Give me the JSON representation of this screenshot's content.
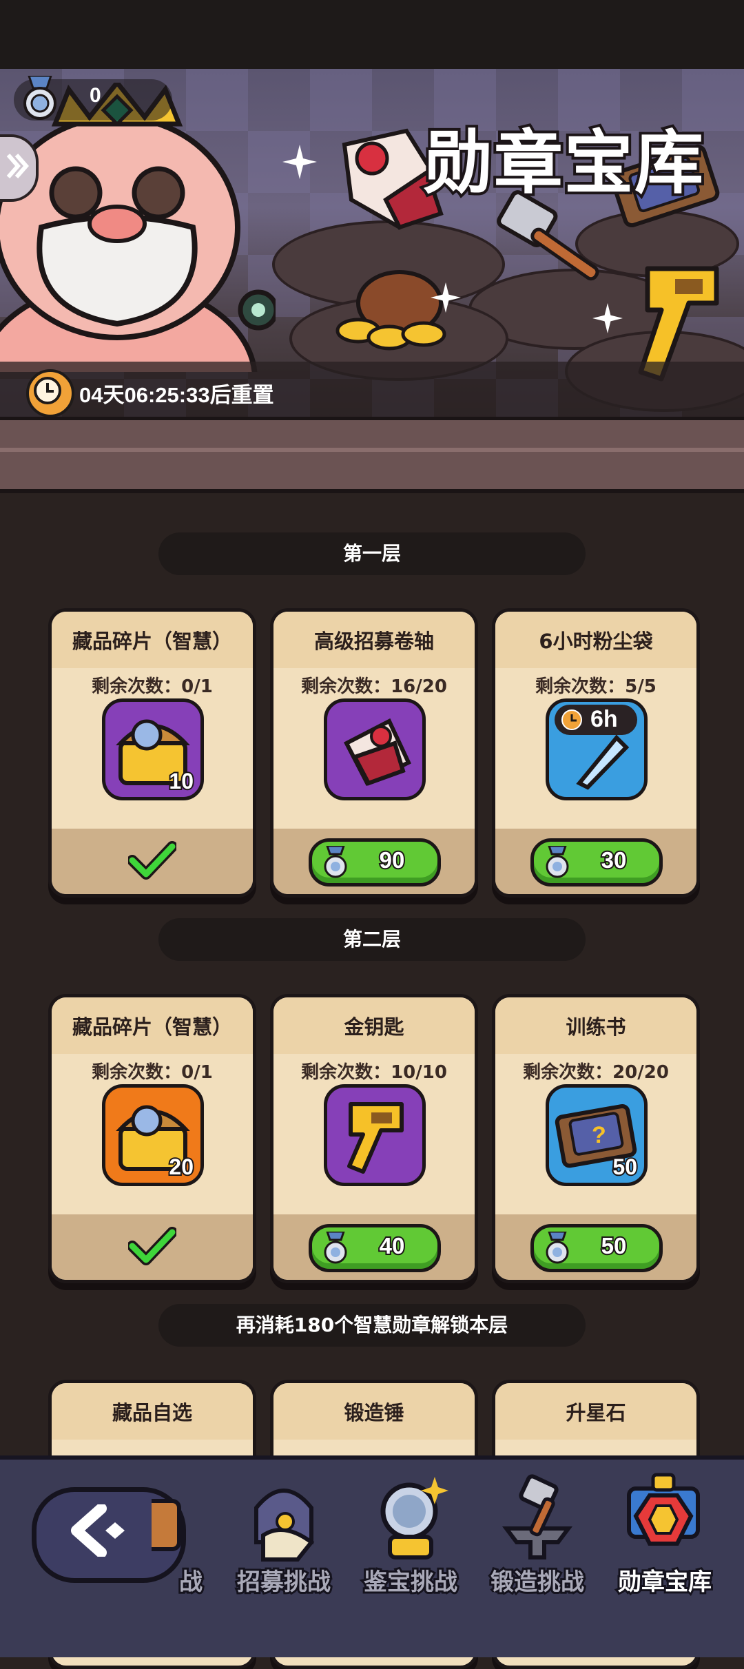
{
  "header": {
    "medal_count": "0",
    "title": "勋章宝库",
    "reset_timer": "04天06:25:33后重置"
  },
  "layers": [
    {
      "header": "第一层",
      "items": [
        {
          "name": "藏品碎片（智慧）",
          "remaining": "剩余次数：0/1",
          "quantity": "10",
          "icon": "treasure-chest-icon",
          "bg": "#8640b8",
          "status": "purchased",
          "price": ""
        },
        {
          "name": "高级招募卷轴",
          "remaining": "剩余次数：16/20",
          "quantity": "",
          "icon": "scroll-icon",
          "bg": "#8640b8",
          "status": "available",
          "price": "90"
        },
        {
          "name": "6小时粉尘袋",
          "remaining": "剩余次数：5/5",
          "quantity": "",
          "icon": "dust-crystal-icon",
          "bg": "#3a9ee0",
          "status": "available",
          "price": "30",
          "badge": "6h"
        }
      ]
    },
    {
      "header": "第二层",
      "items": [
        {
          "name": "藏品碎片（智慧）",
          "remaining": "剩余次数：0/1",
          "quantity": "20",
          "icon": "treasure-chest-icon",
          "bg": "#f07a1a",
          "status": "purchased",
          "price": ""
        },
        {
          "name": "金钥匙",
          "remaining": "剩余次数：10/10",
          "quantity": "",
          "icon": "gold-key-icon",
          "bg": "#8640b8",
          "status": "available",
          "price": "40"
        },
        {
          "name": "训练书",
          "remaining": "剩余次数：20/20",
          "quantity": "50",
          "icon": "training-book-icon",
          "bg": "#3a9ee0",
          "status": "available",
          "price": "50"
        }
      ]
    },
    {
      "header": "再消耗180个智慧勋章解锁本层",
      "items": [
        {
          "name": "藏品自选"
        },
        {
          "name": "锻造锤"
        },
        {
          "name": "升星石"
        }
      ]
    }
  ],
  "nav": {
    "tabs": [
      {
        "label": "战",
        "icon": "partial-tab-icon"
      },
      {
        "label": "招募挑战",
        "icon": "recruit-helmet-icon"
      },
      {
        "label": "鉴宝挑战",
        "icon": "magnifier-icon"
      },
      {
        "label": "锻造挑战",
        "icon": "anvil-hammer-icon"
      },
      {
        "label": "勋章宝库",
        "icon": "medal-treasury-icon",
        "active": true
      }
    ]
  },
  "colors": {
    "accent_green": "#61c935",
    "card_bg": "#f2dfbd",
    "purple": "#8640b8",
    "blue": "#3a9ee0",
    "orange": "#f07a1a"
  }
}
